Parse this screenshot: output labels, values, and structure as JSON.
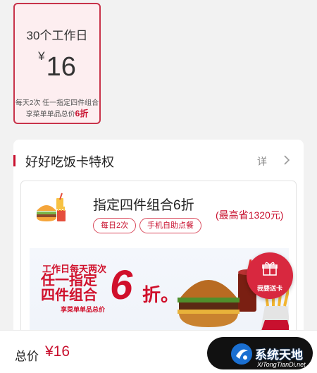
{
  "plan": {
    "title": "30个工作日",
    "currency": "¥",
    "price": "16",
    "desc_line1": "每天2次 任一指定四件组合",
    "desc_line2_prefix": "享菜单单品总价",
    "desc_line2_highlight": "6折"
  },
  "privilege": {
    "title": "好好吃饭卡特权",
    "detail_label": "详",
    "offer": {
      "title": "指定四件组合6折",
      "saving": "(最高省1320元)",
      "tags": [
        "每日2次",
        "手机自助点餐"
      ]
    },
    "banner": {
      "line1": "工作日每天两次",
      "line2": "任一指定",
      "line3": "四件组合",
      "small": "享菜单单品总价",
      "big_number": "6",
      "big_unit": "折。"
    },
    "gift_button_label": "我要送卡"
  },
  "bottom_bar": {
    "total_label": "总价",
    "total_price": "¥16"
  },
  "watermark": {
    "title": "系统天地",
    "url": "XiTongTianDi.net"
  },
  "colors": {
    "brand_red": "#c8102e",
    "plan_bg": "#fdeef0",
    "page_bg": "#f2f2f2"
  },
  "icons": [
    "combo-meal-icon",
    "chevron-right-icon",
    "gift-icon",
    "watermark-logo-icon"
  ]
}
